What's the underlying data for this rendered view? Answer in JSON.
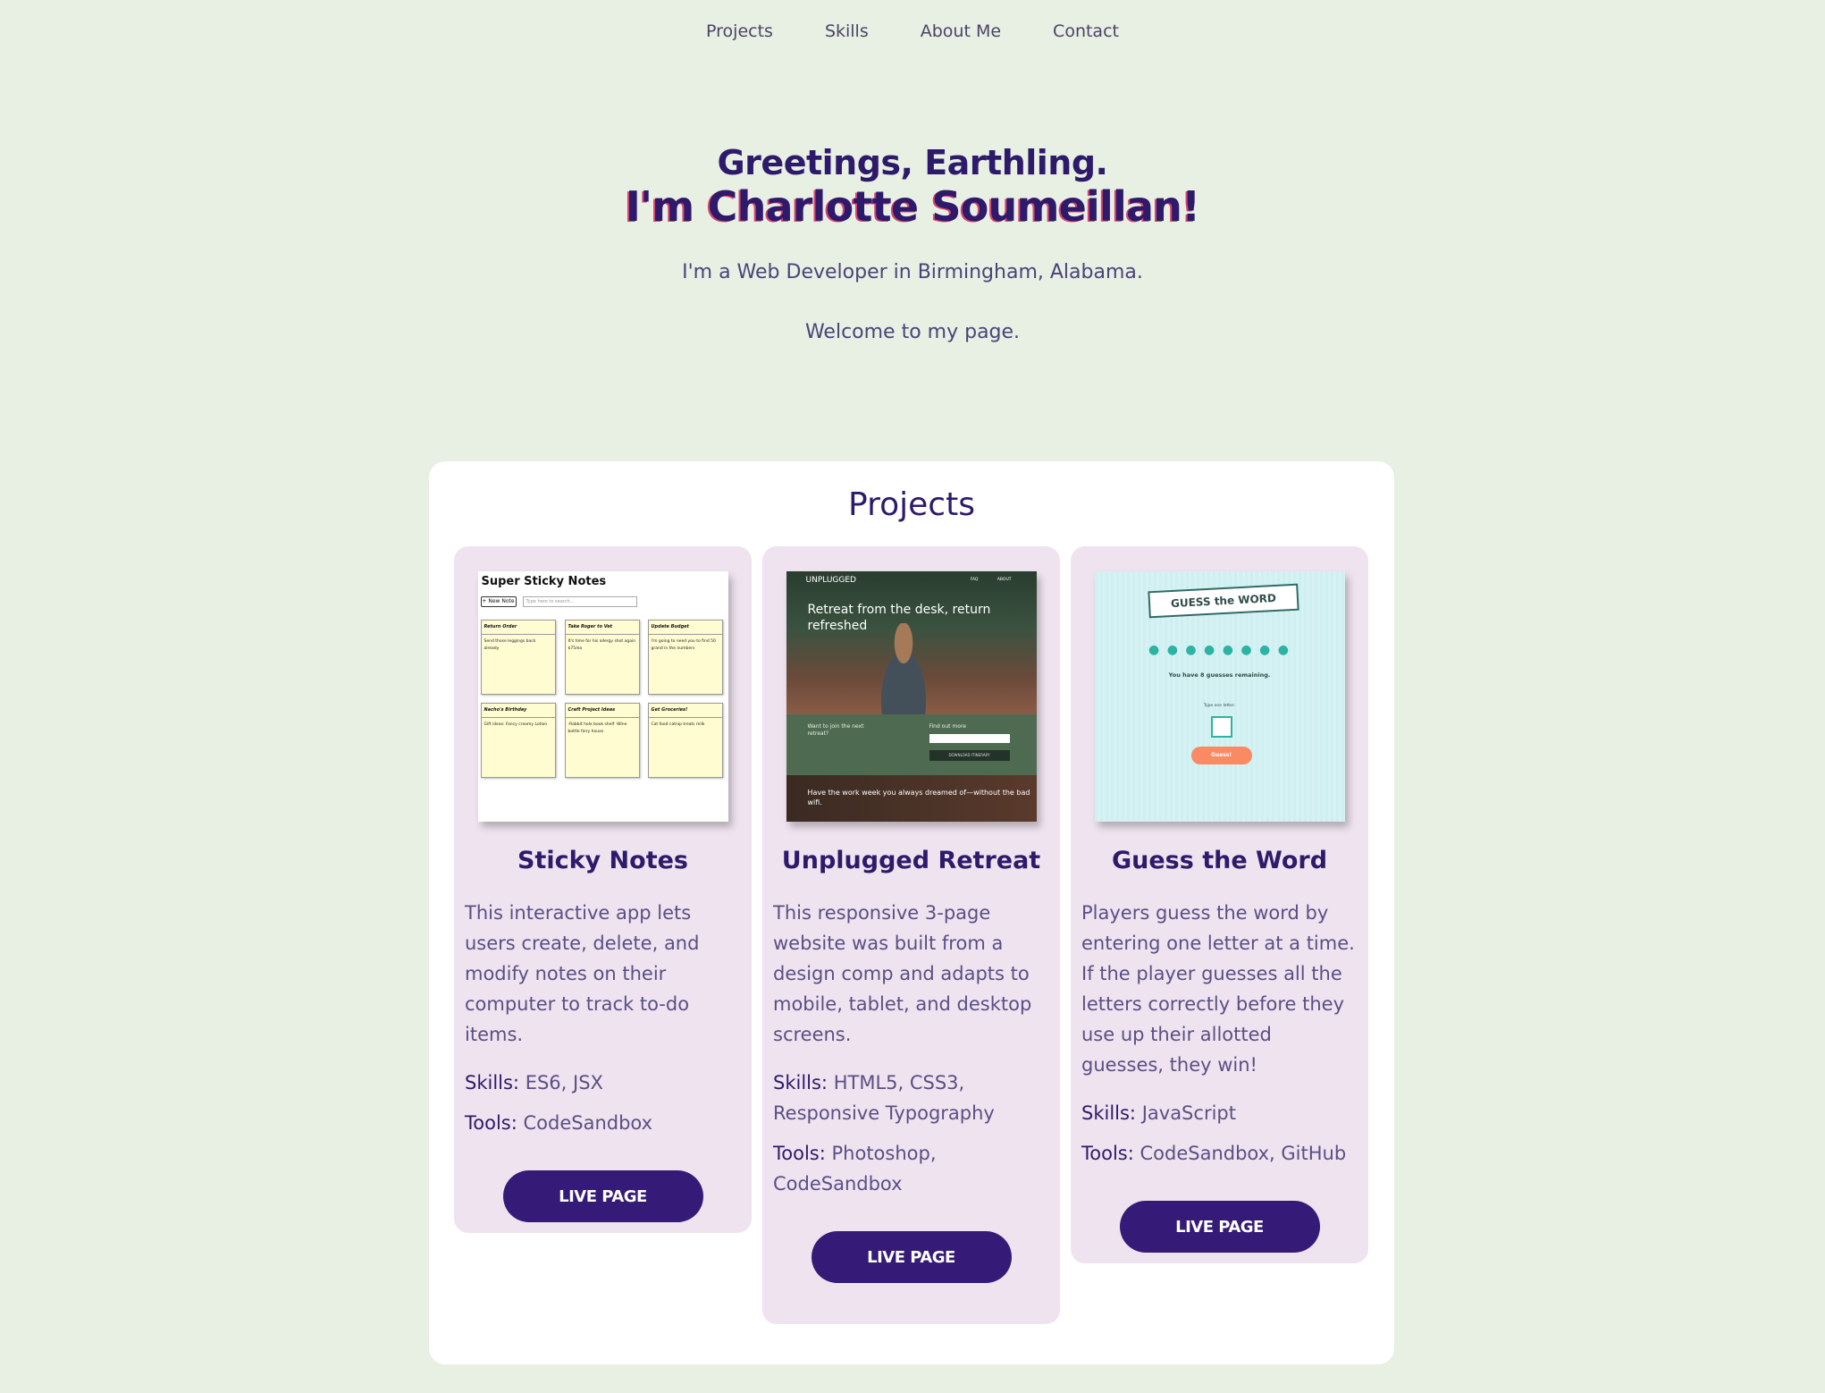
{
  "nav": {
    "items": [
      {
        "label": "Projects"
      },
      {
        "label": "Skills"
      },
      {
        "label": "About Me"
      },
      {
        "label": "Contact"
      }
    ]
  },
  "hero": {
    "greeting": "Greetings, Earthling.",
    "name": "I'm Charlotte Soumeillan!",
    "subtitle": "I'm a Web Developer in Birmingham, Alabama.",
    "welcome": "Welcome to my page."
  },
  "projects": {
    "title": "Projects",
    "items": [
      {
        "title": "Sticky Notes",
        "description": "This interactive app lets users create, delete, and modify notes on their computer to track to-do items.",
        "skills_label": "Skills:",
        "skills": "ES6, JSX",
        "tools_label": "Tools:",
        "tools": "CodeSandbox",
        "button": "LIVE PAGE",
        "thumb": {
          "app_title": "Super Sticky Notes",
          "new_note": "+ New Note",
          "search_placeholder": "Type here to search...",
          "notes": [
            {
              "title": "Return Order",
              "body": "Send those leggings back already"
            },
            {
              "title": "Take Roger to Vet",
              "body": "It's time for his allergy shot again $75/ea"
            },
            {
              "title": "Update Budget",
              "body": "I'm going to need you to find 50 grand in the numbers"
            },
            {
              "title": "Nacho's Birthday",
              "body": "Gift ideas: Fancy creamy Lotion"
            },
            {
              "title": "Craft Project Ideas",
              "body": "-Rabbit hole book shelf -Wine bottle fairy house"
            },
            {
              "title": "Get Groceries!",
              "body": "Cat food catnip treats milk"
            }
          ]
        }
      },
      {
        "title": "Unplugged Retreat",
        "description": "This responsive 3-page website was built from a design comp and adapts to mobile, tablet, and desktop screens.",
        "skills_label": "Skills:",
        "skills": "HTML5, CSS3, Responsive Typography",
        "tools_label": "Tools:",
        "tools": "Photoshop, CodeSandbox",
        "button": "LIVE PAGE",
        "thumb": {
          "logo": "UNPLUGGED",
          "nav": "FAQ ABOUT",
          "headline": "Retreat from the desk, return refreshed",
          "band_left": "Want to join the next retreat?",
          "band_right": "Find out more",
          "download": "DOWNLOAD ITINERARY",
          "footer": "Have the work week you always dreamed of—without the bad wifi."
        }
      },
      {
        "title": "Guess the Word",
        "description": "Players guess the word by entering one letter at a time. If the player guesses all the letters correctly before they use up their allotted guesses, they win!",
        "skills_label": "Skills:",
        "skills": "JavaScript",
        "tools_label": "Tools:",
        "tools": "CodeSandbox, GitHub",
        "button": "LIVE PAGE",
        "thumb": {
          "banner": "GUESS the WORD",
          "dots": "● ● ● ● ● ● ● ●",
          "remaining": "You have 8 guesses remaining.",
          "label": "Type one letter:",
          "guess": "Guess!"
        }
      }
    ]
  }
}
